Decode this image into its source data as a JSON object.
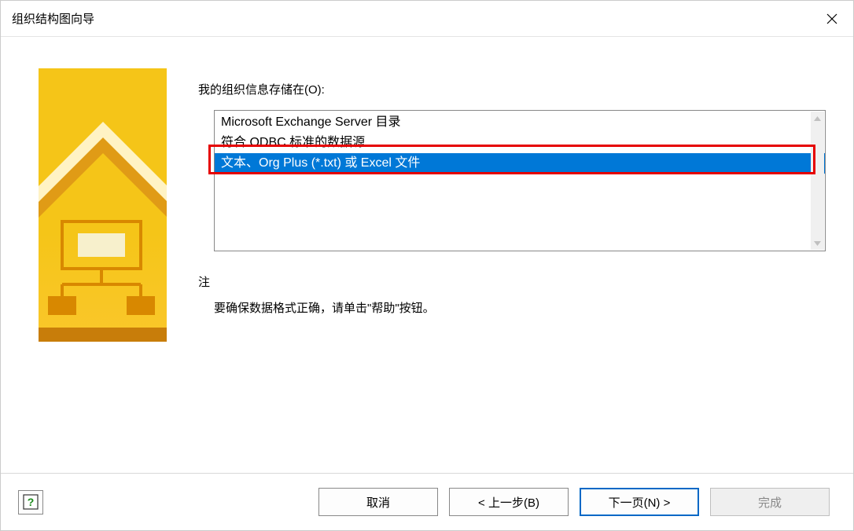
{
  "titlebar": {
    "title": "组织结构图向导"
  },
  "main": {
    "field_label": "我的组织信息存储在(O):",
    "list_items": [
      "Microsoft Exchange Server 目录",
      "符合 ODBC 标准的数据源",
      "文本、Org Plus (*.txt) 或 Excel 文件"
    ],
    "note_label": "注",
    "note_text": "要确保数据格式正确，请单击\"帮助\"按钮。"
  },
  "footer": {
    "cancel": "取消",
    "back": "< 上一步(B)",
    "next": "下一页(N) >",
    "finish": "完成"
  }
}
